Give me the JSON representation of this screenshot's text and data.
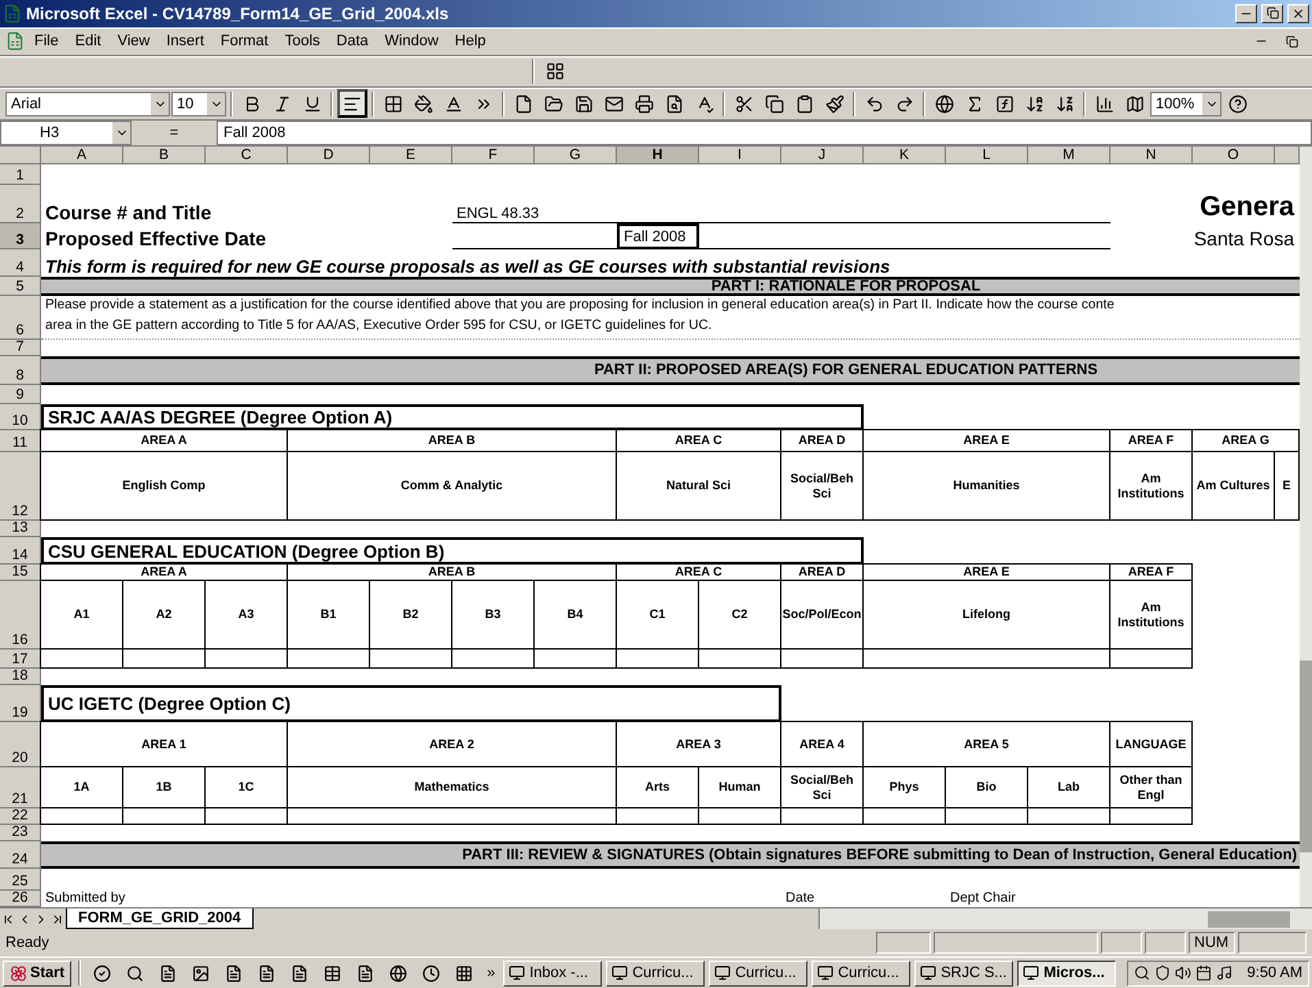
{
  "window": {
    "title": "Microsoft Excel - CV14789_Form14_GE_Grid_2004.xls"
  },
  "menu": [
    "File",
    "Edit",
    "View",
    "Insert",
    "Format",
    "Tools",
    "Data",
    "Window",
    "Help"
  ],
  "formatting": {
    "font": "Arial",
    "size": "10",
    "align_left_pressed": true
  },
  "standard": {
    "zoom": "100%"
  },
  "formula_bar": {
    "name_box": "H3",
    "sign": "=",
    "value": "Fall 2008"
  },
  "sheet": {
    "columns": [
      {
        "label": "A",
        "selected": false
      },
      {
        "label": "B",
        "selected": false
      },
      {
        "label": "C",
        "selected": false
      },
      {
        "label": "D",
        "selected": false
      },
      {
        "label": "E",
        "selected": false
      },
      {
        "label": "F",
        "selected": false
      },
      {
        "label": "G",
        "selected": false
      },
      {
        "label": "H",
        "selected": true
      },
      {
        "label": "I",
        "selected": false
      },
      {
        "label": "J",
        "selected": false
      },
      {
        "label": "K",
        "selected": false
      },
      {
        "label": "L",
        "selected": false
      },
      {
        "label": "M",
        "selected": false
      },
      {
        "label": "N",
        "selected": false
      },
      {
        "label": "O",
        "selected": false
      }
    ],
    "rows": [
      {
        "num": "1",
        "selected": false
      },
      {
        "num": "2",
        "selected": false,
        "cells": [
          {
            "kind": "heading",
            "text": "Course # and Title"
          },
          {
            "kind": "field",
            "text": "ENGL 48.33"
          },
          {
            "kind": "title",
            "text": "Genera"
          }
        ]
      },
      {
        "num": "3",
        "selected": true,
        "cells": [
          {
            "kind": "heading",
            "text": "Proposed Effective Date"
          },
          {
            "kind": "field"
          },
          {
            "kind": "field",
            "text": "Fall 2008",
            "selected": true
          },
          {
            "kind": "field"
          },
          {
            "kind": "subtitle",
            "text": "Santa Rosa"
          }
        ]
      },
      {
        "num": "4",
        "selected": false,
        "cells": [
          {
            "kind": "note",
            "text": "This form is required for new GE course proposals as well as GE courses with substantial revisions"
          }
        ]
      },
      {
        "num": "5",
        "selected": false,
        "cells": [
          {
            "kind": "band",
            "text": "PART I:  RATIONALE FOR PROPOSAL"
          }
        ]
      },
      {
        "num": "6",
        "selected": false,
        "cells": [
          {
            "kind": "para",
            "lines": [
              "Please provide a statement as a justification for the course identified above that you are proposing for inclusion in general education area(s) in Part II.  Indicate how the course conte",
              "area in the GE pattern according to Title 5 for AA/AS, Executive Order 595 for CSU, or IGETC guidelines for UC."
            ]
          }
        ]
      },
      {
        "num": "7",
        "selected": false
      },
      {
        "num": "8",
        "selected": false,
        "cells": [
          {
            "kind": "band",
            "text": "PART II:  PROPOSED AREA(S) FOR GENERAL EDUCATION PATTERNS"
          }
        ]
      },
      {
        "num": "9",
        "selected": false
      },
      {
        "num": "10",
        "selected": false,
        "cells": [
          {
            "kind": "section",
            "text": "SRJC  AA/AS DEGREE  (Degree Option A)"
          }
        ]
      },
      {
        "num": "11",
        "selected": false,
        "cells": [
          {
            "kind": "area",
            "text": "AREA A"
          },
          {
            "kind": "area",
            "text": "AREA B"
          },
          {
            "kind": "area",
            "text": "AREA C"
          },
          {
            "kind": "area",
            "text": "AREA D"
          },
          {
            "kind": "area",
            "text": "AREA E"
          },
          {
            "kind": "area",
            "text": "AREA F"
          },
          {
            "kind": "area",
            "text": "AREA G"
          }
        ]
      },
      {
        "num": "12",
        "selected": false,
        "cells": [
          {
            "kind": "area",
            "text": "English Comp"
          },
          {
            "kind": "area",
            "text": "Comm & Analytic"
          },
          {
            "kind": "area",
            "text": "Natural Sci"
          },
          {
            "kind": "area",
            "text": "Social/Beh Sci"
          },
          {
            "kind": "area",
            "text": "Humanities"
          },
          {
            "kind": "area",
            "text": "Am Institutions"
          },
          {
            "kind": "area",
            "text": "Am Cultures"
          },
          {
            "kind": "area",
            "text": "E"
          }
        ]
      },
      {
        "num": "13",
        "selected": false
      },
      {
        "num": "14",
        "selected": false,
        "cells": [
          {
            "kind": "section",
            "text": "CSU GENERAL EDUCATION  (Degree Option B)"
          }
        ]
      },
      {
        "num": "15",
        "selected": false,
        "cells": [
          {
            "kind": "area",
            "text": "AREA A"
          },
          {
            "kind": "area",
            "text": "AREA B"
          },
          {
            "kind": "area",
            "text": "AREA C"
          },
          {
            "kind": "area",
            "text": "AREA D"
          },
          {
            "kind": "area",
            "text": "AREA E"
          },
          {
            "kind": "area",
            "text": "AREA F"
          }
        ]
      },
      {
        "num": "16",
        "selected": false,
        "cells": [
          {
            "kind": "area",
            "text": "A1"
          },
          {
            "kind": "area",
            "text": "A2"
          },
          {
            "kind": "area",
            "text": "A3"
          },
          {
            "kind": "area",
            "text": "B1"
          },
          {
            "kind": "area",
            "text": "B2"
          },
          {
            "kind": "area",
            "text": "B3"
          },
          {
            "kind": "area",
            "text": "B4"
          },
          {
            "kind": "area",
            "text": "C1"
          },
          {
            "kind": "area",
            "text": "C2"
          },
          {
            "kind": "area",
            "text": "Soc/Pol/Econ"
          },
          {
            "kind": "area",
            "text": "Lifelong"
          },
          {
            "kind": "area",
            "text": "Am Institutions"
          }
        ]
      },
      {
        "num": "17",
        "selected": false,
        "cells": [
          {
            "kind": "blank"
          },
          {
            "kind": "blank"
          },
          {
            "kind": "blank"
          },
          {
            "kind": "blank"
          },
          {
            "kind": "blank"
          },
          {
            "kind": "blank"
          },
          {
            "kind": "blank"
          },
          {
            "kind": "blank"
          },
          {
            "kind": "blank"
          },
          {
            "kind": "blank"
          },
          {
            "kind": "blank"
          },
          {
            "kind": "blank"
          }
        ]
      },
      {
        "num": "18",
        "selected": false
      },
      {
        "num": "19",
        "selected": false,
        "cells": [
          {
            "kind": "section",
            "text": "UC   IGETC  (Degree Option C)"
          }
        ]
      },
      {
        "num": "20",
        "selected": false,
        "cells": [
          {
            "kind": "area",
            "text": "AREA 1"
          },
          {
            "kind": "area",
            "text": "AREA 2"
          },
          {
            "kind": "area",
            "text": "AREA 3"
          },
          {
            "kind": "area",
            "text": "AREA 4"
          },
          {
            "kind": "area",
            "text": "AREA 5"
          },
          {
            "kind": "area",
            "text": "LANGUAGE"
          }
        ]
      },
      {
        "num": "21",
        "selected": false,
        "cells": [
          {
            "kind": "area",
            "text": "1A"
          },
          {
            "kind": "area",
            "text": "1B"
          },
          {
            "kind": "area",
            "text": "1C"
          },
          {
            "kind": "area",
            "text": "Mathematics"
          },
          {
            "kind": "area",
            "text": "Arts"
          },
          {
            "kind": "area",
            "text": "Human"
          },
          {
            "kind": "area",
            "text": "Social/Beh Sci"
          },
          {
            "kind": "area",
            "text": "Phys"
          },
          {
            "kind": "area",
            "text": "Bio"
          },
          {
            "kind": "area",
            "text": "Lab"
          },
          {
            "kind": "area",
            "text": "Other than Engl"
          }
        ]
      },
      {
        "num": "22",
        "selected": false,
        "cells": [
          {
            "kind": "blank"
          },
          {
            "kind": "blank"
          },
          {
            "kind": "blank"
          },
          {
            "kind": "blank"
          },
          {
            "kind": "blank"
          },
          {
            "kind": "blank"
          },
          {
            "kind": "blank"
          },
          {
            "kind": "blank"
          },
          {
            "kind": "blank"
          },
          {
            "kind": "blank"
          },
          {
            "kind": "blank"
          }
        ]
      },
      {
        "num": "23",
        "selected": false
      },
      {
        "num": "24",
        "selected": false,
        "cells": [
          {
            "kind": "band-right",
            "text": "PART III:  REVIEW & SIGNATURES  (Obtain signatures BEFORE submitting to Dean of Instruction, General Education)"
          }
        ]
      },
      {
        "num": "25",
        "selected": false
      },
      {
        "num": "26",
        "selected": false,
        "cells": [
          {
            "kind": "label",
            "text": "Submitted by"
          },
          {
            "kind": "label",
            "text": "Date"
          },
          {
            "kind": "label",
            "text": "Dept Chair"
          }
        ]
      }
    ]
  },
  "sheet_tabs": [
    {
      "label": "FORM_GE_GRID_2004",
      "selected": true
    }
  ],
  "status_bar": {
    "text": "Ready",
    "indicators": [
      "NUM"
    ]
  },
  "taskbar": {
    "start": "Start",
    "more": "»",
    "tasks": [
      {
        "label": "Inbox -...",
        "selected": false
      },
      {
        "label": "Curricu...",
        "selected": false
      },
      {
        "label": "Curricu...",
        "selected": false
      },
      {
        "label": "Curricu...",
        "selected": false
      },
      {
        "label": "SRJC S...",
        "selected": false
      },
      {
        "label": "Micros...",
        "selected": true
      }
    ],
    "clock": "9:50 AM"
  }
}
